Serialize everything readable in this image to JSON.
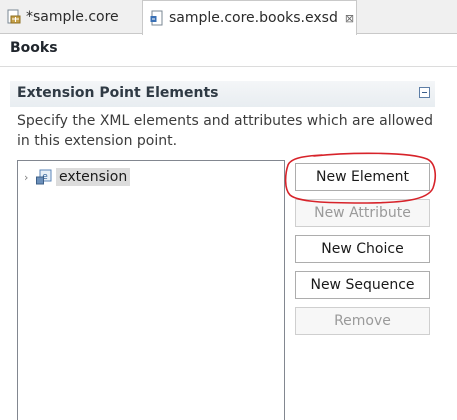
{
  "tabs": [
    {
      "label": "*sample.core",
      "icon": "plugin-manifest-icon",
      "active": false
    },
    {
      "label": "sample.core.books.exsd",
      "icon": "schema-file-icon",
      "active": true,
      "close": "⊠"
    }
  ],
  "page": {
    "title": "Books"
  },
  "section": {
    "title": "Extension Point Elements",
    "description": "Specify the XML elements and attributes which are allowed in this extension point."
  },
  "tree": {
    "items": [
      {
        "label": "extension",
        "icon": "schema-element-icon",
        "expanded": false
      }
    ]
  },
  "buttons": {
    "new_element": "New Element",
    "new_attribute": "New Attribute",
    "new_choice": "New Choice",
    "new_sequence": "New Sequence",
    "remove": "Remove"
  },
  "button_states": {
    "new_element": "enabled",
    "new_attribute": "disabled",
    "new_choice": "enabled",
    "new_sequence": "enabled",
    "remove": "disabled"
  },
  "colors": {
    "annotation": "#d7232a",
    "tree_selection": "#dcdcdc"
  }
}
